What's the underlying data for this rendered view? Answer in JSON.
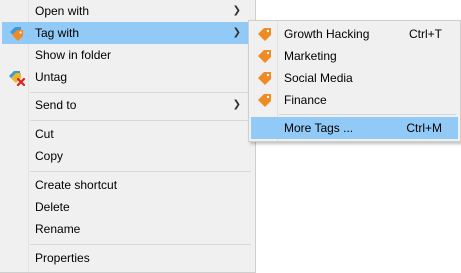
{
  "main_menu": {
    "items": [
      {
        "label": "Open with"
      },
      {
        "label": "Tag with"
      },
      {
        "label": "Show in folder"
      },
      {
        "label": "Untag"
      },
      {
        "label": "Send to"
      },
      {
        "label": "Cut"
      },
      {
        "label": "Copy"
      },
      {
        "label": "Create shortcut"
      },
      {
        "label": "Delete"
      },
      {
        "label": "Rename"
      },
      {
        "label": "Properties"
      }
    ]
  },
  "submenu": {
    "items": [
      {
        "label": "Growth Hacking",
        "shortcut": "Ctrl+T"
      },
      {
        "label": "Marketing"
      },
      {
        "label": "Social Media"
      },
      {
        "label": "Finance"
      },
      {
        "label": "More Tags ...",
        "shortcut": "Ctrl+M"
      }
    ]
  },
  "colors": {
    "menu_bg": "#f0f0f0",
    "selection_bg": "#91c9f7",
    "tag_orange": "#f08a24"
  },
  "icons": {
    "tag": "tag-icon",
    "untag": "untag-icon",
    "submenu_arrow": "chevron-right-icon"
  }
}
